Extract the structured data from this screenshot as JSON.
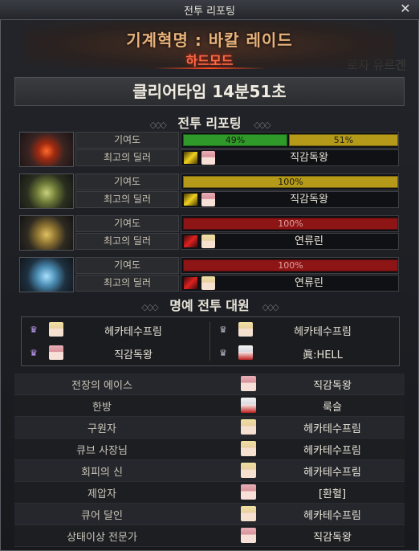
{
  "window": {
    "title": "전투 리포팅",
    "close_glyph": "✕"
  },
  "background_text": "로자 유르겐",
  "raid": {
    "name": "기계혁명 : 바칼 레이드",
    "difficulty": "하드모드"
  },
  "clear_time": "클리어타임  14분51초",
  "section_report": "전투 리포팅",
  "section_honor": "명예 전투 대원",
  "section_deco": "◇◇◇",
  "labels": {
    "contribution": "기여도",
    "best_dealer": "최고의 딜러"
  },
  "bosses": [
    {
      "portrait": "fire-dragon-portrait-icon",
      "bars": [
        {
          "text": "49%",
          "color": "#2f9a2a",
          "value": 49
        },
        {
          "text": "51%",
          "color": "#b59a1a",
          "value": 51
        }
      ],
      "dealer_icon": "yellow-slash-icon",
      "dealer": "직감독왕"
    },
    {
      "portrait": "green-dragon-portrait-icon",
      "bars": [
        {
          "text": "100%",
          "color": "#b59a1a",
          "value": 100
        }
      ],
      "dealer_icon": "yellow-slash-icon",
      "dealer": "직감독왕"
    },
    {
      "portrait": "gold-dragon-portrait-icon",
      "bars": [
        {
          "text": "100%",
          "color": "#8e1515",
          "value": 100
        }
      ],
      "dealer_icon": "red-claw-icon",
      "dealer": "연류린"
    },
    {
      "portrait": "ice-dragon-portrait-icon",
      "bars": [
        {
          "text": "100%",
          "color": "#8e1515",
          "value": 100
        }
      ],
      "dealer_icon": "red-claw-icon",
      "dealer": "연류린"
    }
  ],
  "honor_members": [
    {
      "name": "헤카테수프림",
      "avatar": "blonde-avatar-icon"
    },
    {
      "name": "헤카테수프림",
      "avatar": "blonde-avatar-icon"
    },
    {
      "name": "직감독왕",
      "avatar": "pink-hair-avatar-icon"
    },
    {
      "name": "眞:HELL",
      "avatar": "white-hair-avatar-icon"
    }
  ],
  "awards": [
    {
      "title": "전장의 에이스",
      "winner": "직감독왕"
    },
    {
      "title": "한방",
      "winner": "룩슬"
    },
    {
      "title": "구원자",
      "winner": "헤카테수프림"
    },
    {
      "title": "큐브 사장님",
      "winner": "헤카테수프림"
    },
    {
      "title": "회피의 신",
      "winner": "헤카테수프림"
    },
    {
      "title": "제압자",
      "winner": "[환혈]"
    },
    {
      "title": "큐어 달인",
      "winner": "헤카테수프림"
    },
    {
      "title": "상태이상 전문가",
      "winner": "직감독왕"
    }
  ]
}
